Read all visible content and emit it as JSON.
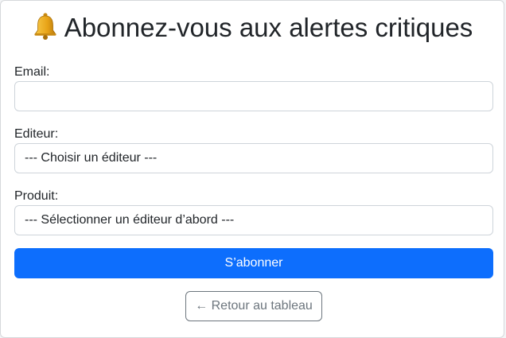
{
  "form": {
    "title": "Abonnez-vous aux alertes critiques",
    "title_icon": "bell-icon",
    "email_label": "Email:",
    "email_value": "",
    "editor_label": "Editeur:",
    "editor_selected": "--- Choisir un éditeur ---",
    "product_label": "Produit:",
    "product_selected": "--- Sélectionner un éditeur d’abord ---",
    "subscribe_label": "S’abonner",
    "back_label": "← Retour au tableau"
  },
  "colors": {
    "primary": "#0d6efd",
    "secondary": "#6c757d",
    "border": "#ced4da",
    "bell": "#e8a317"
  }
}
